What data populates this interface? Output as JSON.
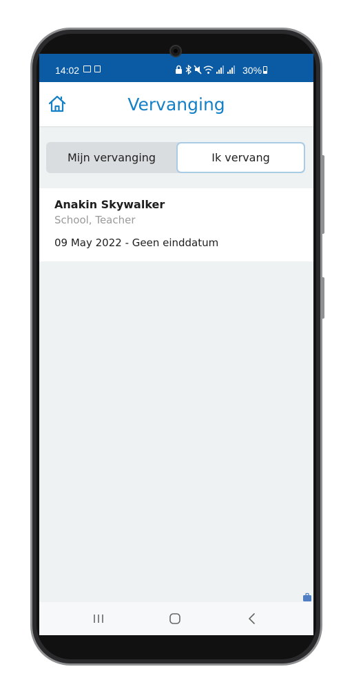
{
  "status_bar": {
    "time": "14:02",
    "battery": "30%",
    "left_icons": [
      "gallery-icon",
      "sim-icon"
    ],
    "right_icons": [
      "lock-icon",
      "bluetooth-icon",
      "mute-icon",
      "wifi-icon",
      "signal-icon",
      "signal-icon"
    ]
  },
  "header": {
    "title": "Vervanging",
    "home_icon": "home-icon"
  },
  "tabs": [
    {
      "label": "Mijn vervanging",
      "selected": false
    },
    {
      "label": "Ik vervang",
      "selected": true
    }
  ],
  "list": [
    {
      "name": "Anakin Skywalker",
      "role": "School, Teacher",
      "period": "09 May 2022 - Geen einddatum"
    }
  ],
  "nav_bar": {
    "buttons": [
      "recent-apps-icon",
      "home-circle-icon",
      "back-icon"
    ]
  },
  "colors": {
    "status_bar": "#0a5ba3",
    "accent": "#1680c6",
    "background": "#eff2f3"
  }
}
